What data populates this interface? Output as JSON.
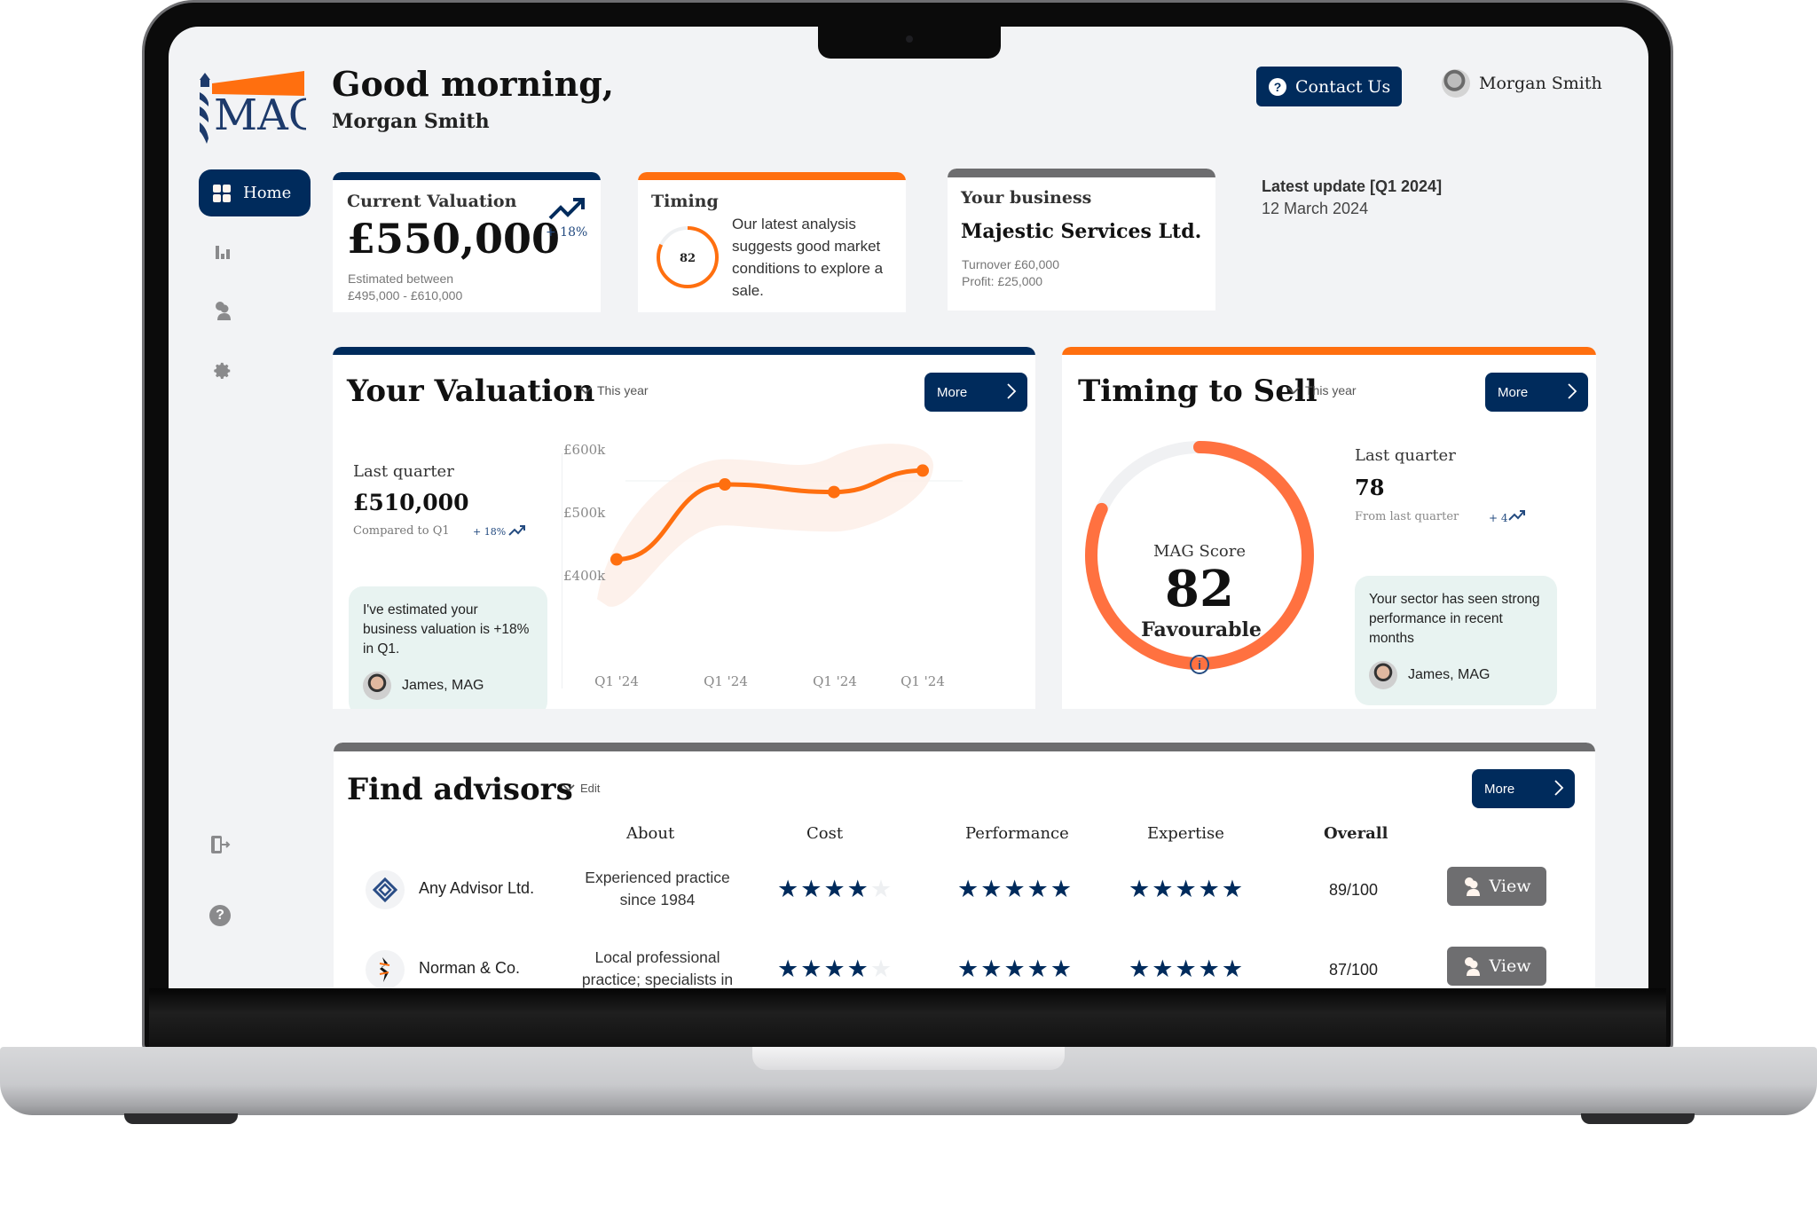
{
  "brand": {
    "logo_text": "MAG",
    "navy": "#002b5c",
    "orange": "#ff6f0f",
    "grey": "#6d6d6f"
  },
  "header": {
    "greeting": "Good morning,",
    "user_name": "Morgan Smith",
    "contact_button": "Contact Us",
    "profile_name": "Morgan Smith"
  },
  "sidebar": {
    "items": [
      {
        "label": "Home",
        "icon": "grid-icon",
        "active": true
      },
      {
        "label": "",
        "icon": "bar-chart-icon"
      },
      {
        "label": "",
        "icon": "users-icon"
      },
      {
        "label": "",
        "icon": "gear-icon"
      }
    ],
    "bottom": [
      {
        "icon": "logout-icon"
      },
      {
        "icon": "help-icon"
      }
    ]
  },
  "summary": {
    "valuation": {
      "title": "Current Valuation",
      "value": "£550,000",
      "change": "+ 18%",
      "range_label": "Estimated between",
      "range": "£495,000 - £610,000"
    },
    "timing": {
      "title": "Timing",
      "score": "82",
      "score_fraction": 0.82,
      "text": "Our latest analysis suggests good market conditions to explore a sale."
    },
    "business": {
      "title": "Your business",
      "name": "Majestic Services Ltd.",
      "turnover": "Turnover £60,000",
      "profit": "Profit: £25,000"
    },
    "update": {
      "title": "Latest update [Q1 2024]",
      "date": "12 March 2024"
    }
  },
  "valuation_panel": {
    "title": "Your Valuation",
    "period": "This year",
    "more": "More",
    "last_quarter_label": "Last quarter",
    "last_quarter_value": "£510,000",
    "compared_label": "Compared to Q1",
    "compared_change": "+ 18%",
    "note": "I've estimated your business valuation is +18%  in Q1.",
    "note_author": "James, MAG"
  },
  "chart_data": {
    "type": "line",
    "title": "Your Valuation",
    "categories": [
      "Q1 '24",
      "Q1 '24",
      "Q1 '24",
      "Q1 '24"
    ],
    "series": [
      {
        "name": "Valuation",
        "values": [
          426000,
          545000,
          533000,
          567000
        ]
      }
    ],
    "band": {
      "upper": [
        470000,
        585000,
        590000,
        590000
      ],
      "lower": [
        380000,
        480000,
        470000,
        520000
      ]
    },
    "yticks": [
      "£600k",
      "£500k",
      "£400k"
    ],
    "ylim": [
      400000,
      600000
    ],
    "grid": true,
    "xlabel": "",
    "ylabel": ""
  },
  "timing_panel": {
    "title": "Timing to Sell",
    "period": "This year",
    "more": "More",
    "score_label": "MAG Score",
    "score": "82",
    "score_fraction": 0.82,
    "rating": "Favourable",
    "last_quarter_label": "Last quarter",
    "last_quarter_value": "78",
    "from_label": "From last quarter",
    "change": "+ 4",
    "note": "Your sector has seen strong performance in recent months",
    "note_author": "James, MAG"
  },
  "advisors": {
    "title": "Find advisors",
    "edit": "Edit",
    "more": "More",
    "columns": [
      "About",
      "Cost",
      "Performance",
      "Expertise",
      "Overall"
    ],
    "rows": [
      {
        "name": "Any Advisor Ltd.",
        "about": "Experienced practice since 1984",
        "cost": 4,
        "performance": 5,
        "expertise": 5,
        "overall": "89/100",
        "action": "View"
      },
      {
        "name": "Norman & Co.",
        "about": "Local professional practice; specialists in",
        "cost": 4,
        "performance": 5,
        "expertise": 5,
        "overall": "87/100",
        "action": "View"
      }
    ]
  }
}
